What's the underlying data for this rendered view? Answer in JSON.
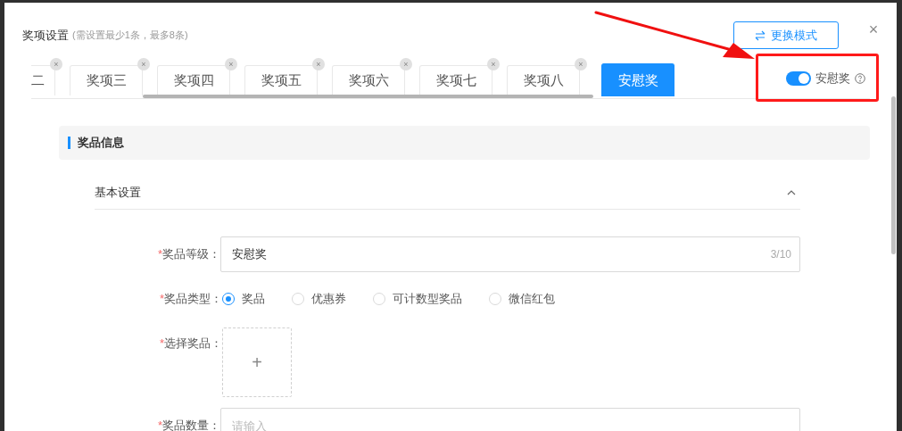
{
  "dialog": {
    "title": "奖项设置",
    "hint": "(需设置最少1条，最多8条)",
    "switch_mode_button": "更换模式",
    "close": "×"
  },
  "tabs": [
    {
      "label": "二",
      "kind": "partial",
      "selected": false,
      "close": "×"
    },
    {
      "label": "奖项三",
      "kind": "full",
      "selected": false,
      "close": "×"
    },
    {
      "label": "奖项四",
      "kind": "full",
      "selected": false,
      "close": "×"
    },
    {
      "label": "奖项五",
      "kind": "full",
      "selected": false,
      "close": "×"
    },
    {
      "label": "奖项六",
      "kind": "full",
      "selected": false,
      "close": "×"
    },
    {
      "label": "奖项七",
      "kind": "full",
      "selected": false,
      "close": "×"
    },
    {
      "label": "奖项八",
      "kind": "full",
      "selected": false,
      "close": "×"
    },
    {
      "label": "安慰奖",
      "kind": "full",
      "selected": true
    }
  ],
  "consolation_toggle": {
    "label": "安慰奖",
    "on": true
  },
  "section": {
    "title": "奖品信息"
  },
  "group": {
    "title": "基本设置",
    "expanded": true
  },
  "form": [
    {
      "kind": "text",
      "label": "奖品等级：",
      "required_mark": "*",
      "value": "安慰奖",
      "counter": "3/10"
    },
    {
      "kind": "radio",
      "label": "奖品类型：",
      "required_mark": "*",
      "options": [
        {
          "label": "奖品",
          "selected": true
        },
        {
          "label": "优惠券",
          "selected": false
        },
        {
          "label": "可计数型奖品",
          "selected": false
        },
        {
          "label": "微信红包",
          "selected": false
        }
      ]
    },
    {
      "kind": "upload",
      "label": "选择奖品：",
      "required_mark": "*",
      "icon": "+"
    },
    {
      "kind": "text",
      "label": "奖品数量：",
      "required_mark": "*",
      "placeholder": "请输入"
    }
  ]
}
